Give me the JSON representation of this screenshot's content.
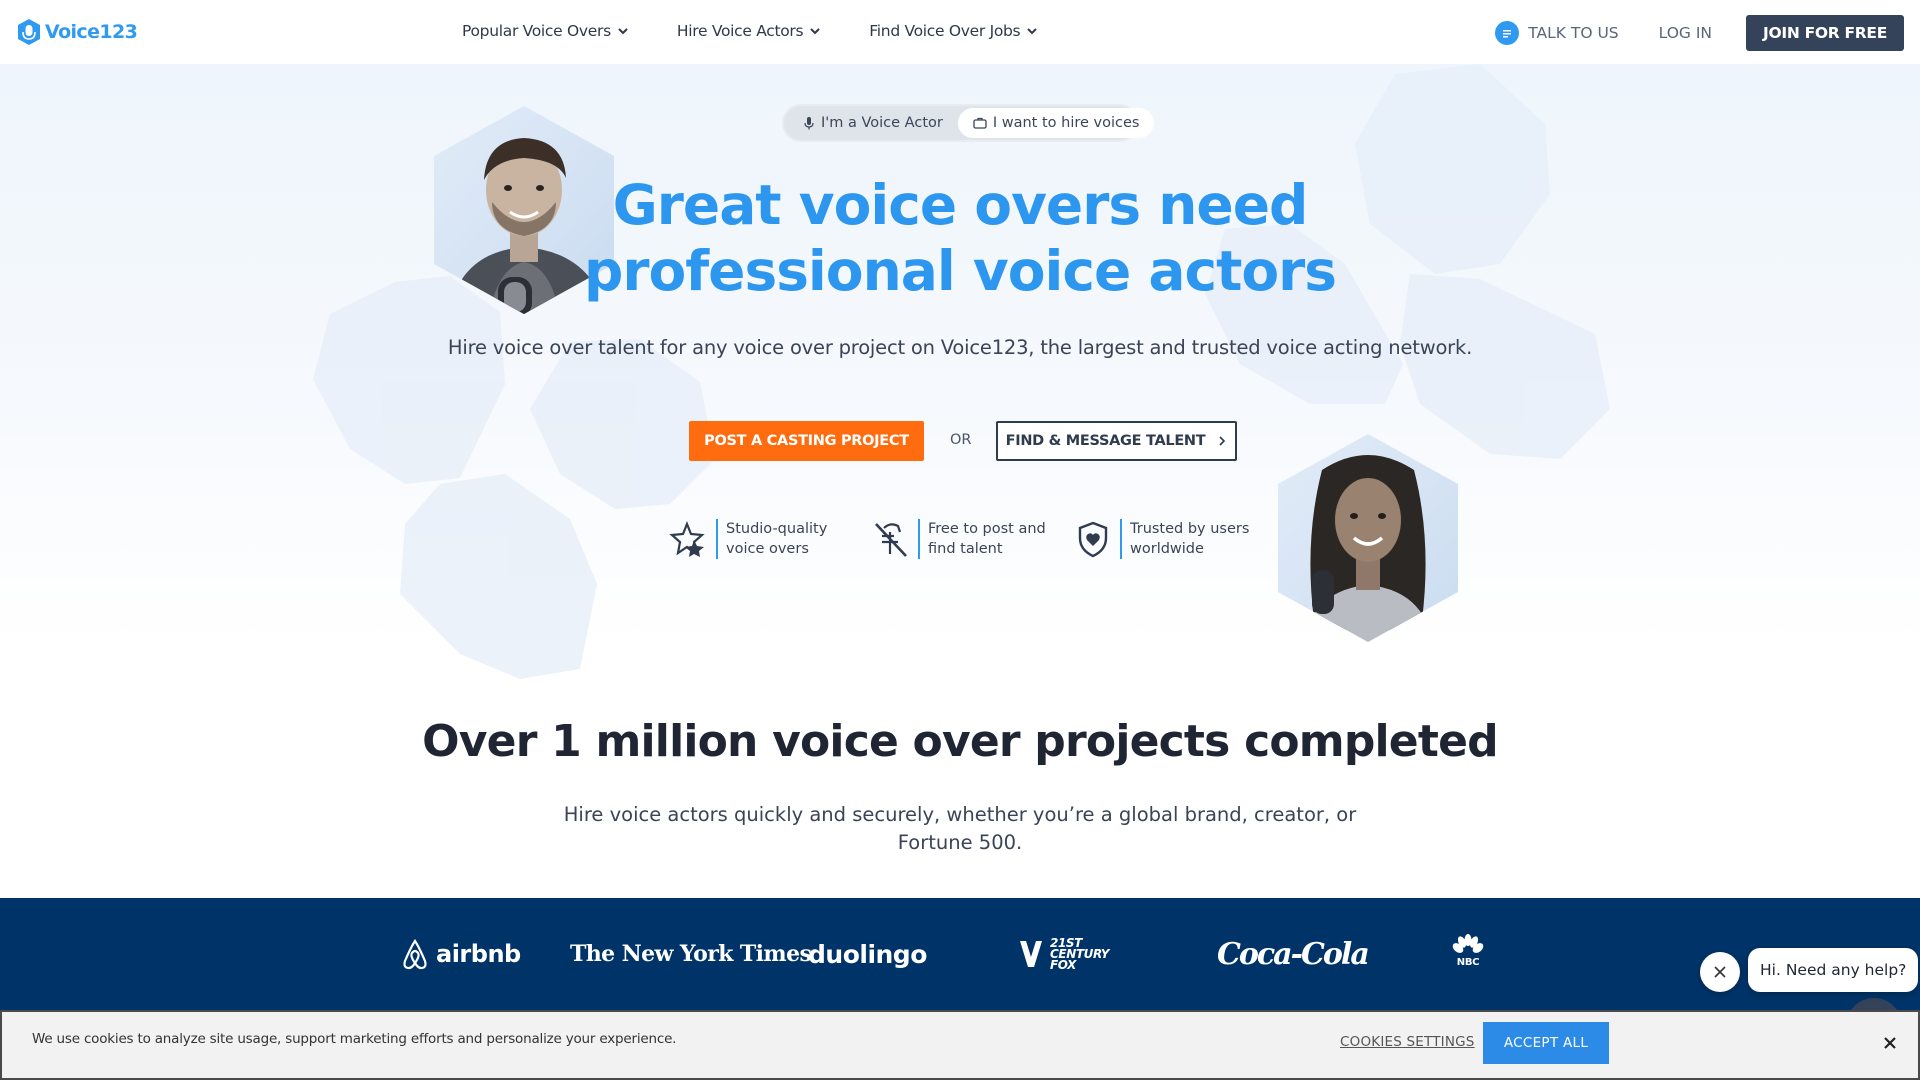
{
  "header": {
    "logo_text": "Voice123",
    "nav": [
      {
        "label": "Popular Voice Overs"
      },
      {
        "label": "Hire Voice Actors"
      },
      {
        "label": "Find Voice Over Jobs"
      }
    ],
    "talk_label": "TALK TO US",
    "login_label": "LOG IN",
    "join_label": "JOIN FOR FREE"
  },
  "toggle": {
    "option_actor": "I'm a Voice Actor",
    "option_hire": "I want to hire voices",
    "selected": "I want to hire voices"
  },
  "hero": {
    "headline_line1": "Great voice overs need",
    "headline_line2": "professional voice actors",
    "subhead": "Hire voice over talent for any voice over project on Voice123, the largest and trusted voice acting network.",
    "post_button": "POST A CASTING PROJECT",
    "or_text": "OR",
    "find_button": "FIND & MESSAGE TALENT"
  },
  "features": [
    {
      "icon": "star-icon",
      "line1": "Studio-quality",
      "line2": "voice overs"
    },
    {
      "icon": "no-fee-icon",
      "line1": "Free to post and",
      "line2": "find talent"
    },
    {
      "icon": "shield-heart-icon",
      "line1": "Trusted by users",
      "line2": "worldwide"
    }
  ],
  "stats": {
    "title": "Over 1 million voice over projects completed",
    "subtitle_line1": "Hire voice actors quickly and securely, whether you’re a global brand, creator, or",
    "subtitle_line2": "Fortune 500."
  },
  "brands": {
    "airbnb": "airbnb",
    "nyt": "The New York Times",
    "duolingo": "duolingo",
    "fox": "21ST CENTURY FOX",
    "fox_l1": "21ST",
    "fox_l2": "CENTURY",
    "fox_l3": "FOX",
    "coke": "Coca-Cola",
    "nbc": "NBC"
  },
  "chat": {
    "bubble_text": "Hi. Need any help?"
  },
  "cookie": {
    "message": "We use cookies to analyze site usage, support marketing efforts and personalize your experience.",
    "settings_label": "COOKIES SETTINGS",
    "accept_label": "ACCEPT ALL"
  },
  "colors": {
    "brand_blue": "#2d96ee",
    "cta_orange": "#ff6c10",
    "dark_navy": "#34435a",
    "band_navy": "#003469"
  }
}
